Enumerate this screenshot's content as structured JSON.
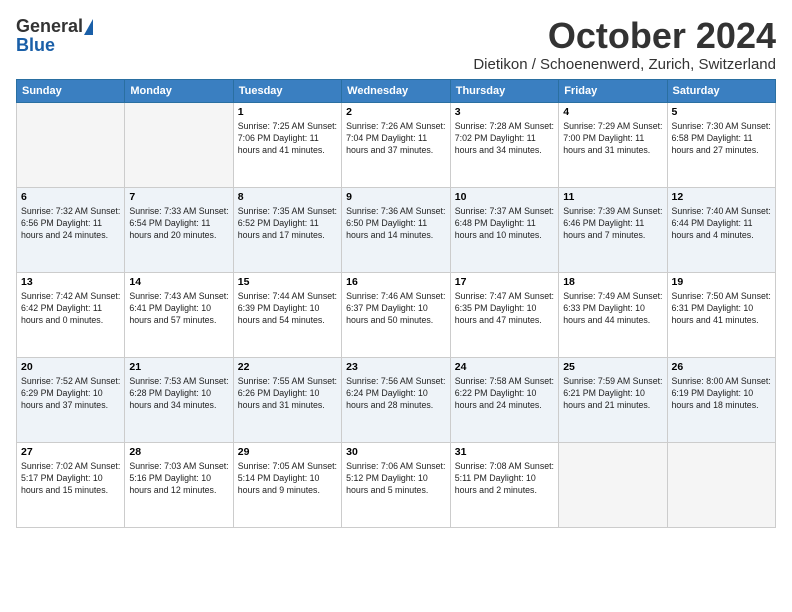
{
  "header": {
    "logo_general": "General",
    "logo_blue": "Blue",
    "title": "October 2024",
    "location": "Dietikon / Schoenenwerd, Zurich, Switzerland"
  },
  "weekdays": [
    "Sunday",
    "Monday",
    "Tuesday",
    "Wednesday",
    "Thursday",
    "Friday",
    "Saturday"
  ],
  "weeks": [
    [
      {
        "day": "",
        "detail": ""
      },
      {
        "day": "",
        "detail": ""
      },
      {
        "day": "1",
        "detail": "Sunrise: 7:25 AM\nSunset: 7:06 PM\nDaylight: 11 hours and 41 minutes."
      },
      {
        "day": "2",
        "detail": "Sunrise: 7:26 AM\nSunset: 7:04 PM\nDaylight: 11 hours and 37 minutes."
      },
      {
        "day": "3",
        "detail": "Sunrise: 7:28 AM\nSunset: 7:02 PM\nDaylight: 11 hours and 34 minutes."
      },
      {
        "day": "4",
        "detail": "Sunrise: 7:29 AM\nSunset: 7:00 PM\nDaylight: 11 hours and 31 minutes."
      },
      {
        "day": "5",
        "detail": "Sunrise: 7:30 AM\nSunset: 6:58 PM\nDaylight: 11 hours and 27 minutes."
      }
    ],
    [
      {
        "day": "6",
        "detail": "Sunrise: 7:32 AM\nSunset: 6:56 PM\nDaylight: 11 hours and 24 minutes."
      },
      {
        "day": "7",
        "detail": "Sunrise: 7:33 AM\nSunset: 6:54 PM\nDaylight: 11 hours and 20 minutes."
      },
      {
        "day": "8",
        "detail": "Sunrise: 7:35 AM\nSunset: 6:52 PM\nDaylight: 11 hours and 17 minutes."
      },
      {
        "day": "9",
        "detail": "Sunrise: 7:36 AM\nSunset: 6:50 PM\nDaylight: 11 hours and 14 minutes."
      },
      {
        "day": "10",
        "detail": "Sunrise: 7:37 AM\nSunset: 6:48 PM\nDaylight: 11 hours and 10 minutes."
      },
      {
        "day": "11",
        "detail": "Sunrise: 7:39 AM\nSunset: 6:46 PM\nDaylight: 11 hours and 7 minutes."
      },
      {
        "day": "12",
        "detail": "Sunrise: 7:40 AM\nSunset: 6:44 PM\nDaylight: 11 hours and 4 minutes."
      }
    ],
    [
      {
        "day": "13",
        "detail": "Sunrise: 7:42 AM\nSunset: 6:42 PM\nDaylight: 11 hours and 0 minutes."
      },
      {
        "day": "14",
        "detail": "Sunrise: 7:43 AM\nSunset: 6:41 PM\nDaylight: 10 hours and 57 minutes."
      },
      {
        "day": "15",
        "detail": "Sunrise: 7:44 AM\nSunset: 6:39 PM\nDaylight: 10 hours and 54 minutes."
      },
      {
        "day": "16",
        "detail": "Sunrise: 7:46 AM\nSunset: 6:37 PM\nDaylight: 10 hours and 50 minutes."
      },
      {
        "day": "17",
        "detail": "Sunrise: 7:47 AM\nSunset: 6:35 PM\nDaylight: 10 hours and 47 minutes."
      },
      {
        "day": "18",
        "detail": "Sunrise: 7:49 AM\nSunset: 6:33 PM\nDaylight: 10 hours and 44 minutes."
      },
      {
        "day": "19",
        "detail": "Sunrise: 7:50 AM\nSunset: 6:31 PM\nDaylight: 10 hours and 41 minutes."
      }
    ],
    [
      {
        "day": "20",
        "detail": "Sunrise: 7:52 AM\nSunset: 6:29 PM\nDaylight: 10 hours and 37 minutes."
      },
      {
        "day": "21",
        "detail": "Sunrise: 7:53 AM\nSunset: 6:28 PM\nDaylight: 10 hours and 34 minutes."
      },
      {
        "day": "22",
        "detail": "Sunrise: 7:55 AM\nSunset: 6:26 PM\nDaylight: 10 hours and 31 minutes."
      },
      {
        "day": "23",
        "detail": "Sunrise: 7:56 AM\nSunset: 6:24 PM\nDaylight: 10 hours and 28 minutes."
      },
      {
        "day": "24",
        "detail": "Sunrise: 7:58 AM\nSunset: 6:22 PM\nDaylight: 10 hours and 24 minutes."
      },
      {
        "day": "25",
        "detail": "Sunrise: 7:59 AM\nSunset: 6:21 PM\nDaylight: 10 hours and 21 minutes."
      },
      {
        "day": "26",
        "detail": "Sunrise: 8:00 AM\nSunset: 6:19 PM\nDaylight: 10 hours and 18 minutes."
      }
    ],
    [
      {
        "day": "27",
        "detail": "Sunrise: 7:02 AM\nSunset: 5:17 PM\nDaylight: 10 hours and 15 minutes."
      },
      {
        "day": "28",
        "detail": "Sunrise: 7:03 AM\nSunset: 5:16 PM\nDaylight: 10 hours and 12 minutes."
      },
      {
        "day": "29",
        "detail": "Sunrise: 7:05 AM\nSunset: 5:14 PM\nDaylight: 10 hours and 9 minutes."
      },
      {
        "day": "30",
        "detail": "Sunrise: 7:06 AM\nSunset: 5:12 PM\nDaylight: 10 hours and 5 minutes."
      },
      {
        "day": "31",
        "detail": "Sunrise: 7:08 AM\nSunset: 5:11 PM\nDaylight: 10 hours and 2 minutes."
      },
      {
        "day": "",
        "detail": ""
      },
      {
        "day": "",
        "detail": ""
      }
    ]
  ]
}
